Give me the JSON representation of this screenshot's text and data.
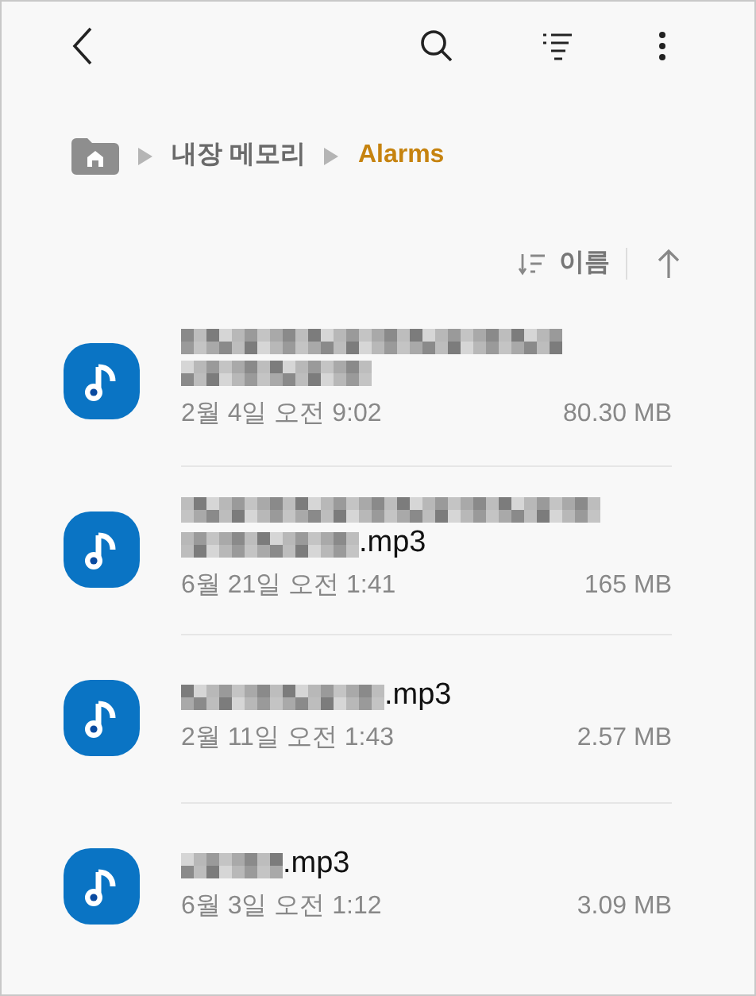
{
  "toolbar": {
    "actions": [
      {
        "kind": "search"
      },
      {
        "kind": "filter"
      },
      {
        "kind": "more"
      }
    ]
  },
  "breadcrumb": {
    "items": [
      {
        "label": "내장 메모리",
        "current": false
      },
      {
        "label": "Alarms",
        "current": true
      }
    ]
  },
  "sort": {
    "label": "이름"
  },
  "files": [
    {
      "name_redacted": true,
      "date": "2월 4일 오전 9:02",
      "size": "80.30 MB"
    },
    {
      "name_redacted": true,
      "name_suffix": ".mp3",
      "date": "6월 21일 오전 1:41",
      "size": "165 MB"
    },
    {
      "name_redacted": true,
      "name_suffix": ".mp3",
      "date": "2월 11일 오전 1:43",
      "size": "2.57 MB"
    },
    {
      "name_redacted": true,
      "name_suffix": ".mp3",
      "date": "6월 3일 오전 1:12",
      "size": "3.09 MB"
    }
  ]
}
